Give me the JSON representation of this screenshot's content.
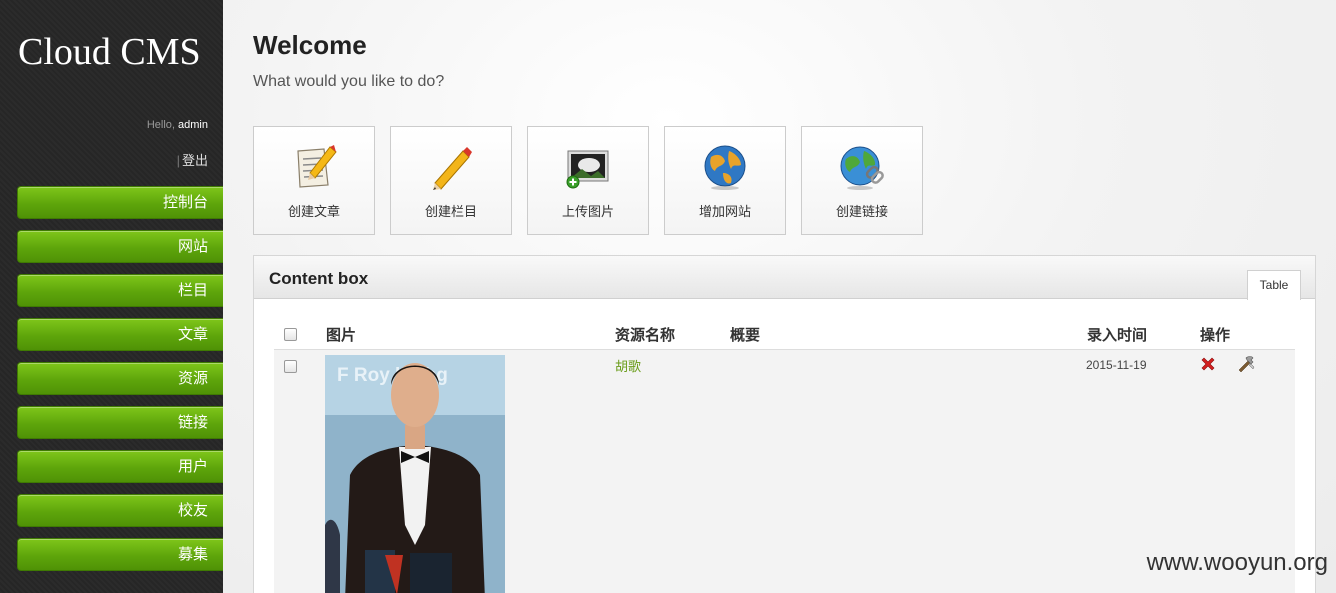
{
  "app": {
    "title": "Cloud CMS"
  },
  "user": {
    "hello_prefix": "Hello, ",
    "name": "admin",
    "logout_sep": "|",
    "logout": "登出"
  },
  "sidebar": {
    "items": [
      {
        "label": "控制台"
      },
      {
        "label": "网站"
      },
      {
        "label": "栏目"
      },
      {
        "label": "文章"
      },
      {
        "label": "资源"
      },
      {
        "label": "链接"
      },
      {
        "label": "用户"
      },
      {
        "label": "校友"
      },
      {
        "label": "募集"
      }
    ]
  },
  "main": {
    "title": "Welcome",
    "subtitle": "What would you like to do?",
    "shortcuts": [
      {
        "label": "创建文章",
        "icon": "edit-document-icon"
      },
      {
        "label": "创建栏目",
        "icon": "pencil-icon"
      },
      {
        "label": "上传图片",
        "icon": "upload-image-icon"
      },
      {
        "label": "增加网站",
        "icon": "globe-icon"
      },
      {
        "label": "创建链接",
        "icon": "globe-link-icon"
      }
    ]
  },
  "content_box": {
    "title": "Content box",
    "tab": "Table",
    "columns": [
      "图片",
      "资源名称",
      "概要",
      "录入时间",
      "操作"
    ],
    "rows": [
      {
        "image_text": "F Roy   l  Rihg",
        "name": "胡歌",
        "summary": "",
        "date": "2015-11-19",
        "actions": [
          "delete-icon",
          "edit-icon"
        ]
      }
    ]
  },
  "watermark": "www.wooyun.org",
  "colors": {
    "accent_green": "#5ea50b",
    "link_green": "#6a9c1a",
    "sidebar_bg": "#2b2b2b"
  }
}
